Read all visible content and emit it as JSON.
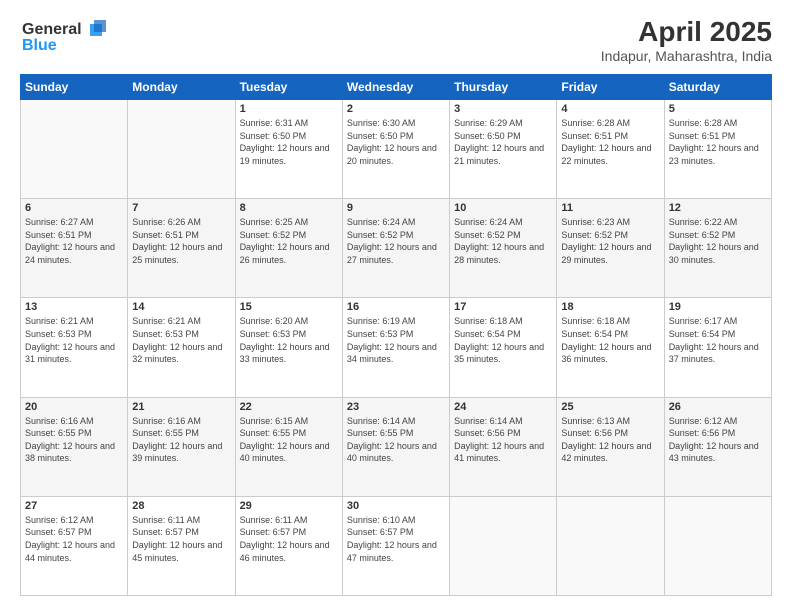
{
  "header": {
    "logo_line1": "General",
    "logo_line2": "Blue",
    "title": "April 2025",
    "subtitle": "Indapur, Maharashtra, India"
  },
  "days_of_week": [
    "Sunday",
    "Monday",
    "Tuesday",
    "Wednesday",
    "Thursday",
    "Friday",
    "Saturday"
  ],
  "weeks": [
    [
      {
        "day": "",
        "sunrise": "",
        "sunset": "",
        "daylight": ""
      },
      {
        "day": "",
        "sunrise": "",
        "sunset": "",
        "daylight": ""
      },
      {
        "day": "1",
        "sunrise": "Sunrise: 6:31 AM",
        "sunset": "Sunset: 6:50 PM",
        "daylight": "Daylight: 12 hours and 19 minutes."
      },
      {
        "day": "2",
        "sunrise": "Sunrise: 6:30 AM",
        "sunset": "Sunset: 6:50 PM",
        "daylight": "Daylight: 12 hours and 20 minutes."
      },
      {
        "day": "3",
        "sunrise": "Sunrise: 6:29 AM",
        "sunset": "Sunset: 6:50 PM",
        "daylight": "Daylight: 12 hours and 21 minutes."
      },
      {
        "day": "4",
        "sunrise": "Sunrise: 6:28 AM",
        "sunset": "Sunset: 6:51 PM",
        "daylight": "Daylight: 12 hours and 22 minutes."
      },
      {
        "day": "5",
        "sunrise": "Sunrise: 6:28 AM",
        "sunset": "Sunset: 6:51 PM",
        "daylight": "Daylight: 12 hours and 23 minutes."
      }
    ],
    [
      {
        "day": "6",
        "sunrise": "Sunrise: 6:27 AM",
        "sunset": "Sunset: 6:51 PM",
        "daylight": "Daylight: 12 hours and 24 minutes."
      },
      {
        "day": "7",
        "sunrise": "Sunrise: 6:26 AM",
        "sunset": "Sunset: 6:51 PM",
        "daylight": "Daylight: 12 hours and 25 minutes."
      },
      {
        "day": "8",
        "sunrise": "Sunrise: 6:25 AM",
        "sunset": "Sunset: 6:52 PM",
        "daylight": "Daylight: 12 hours and 26 minutes."
      },
      {
        "day": "9",
        "sunrise": "Sunrise: 6:24 AM",
        "sunset": "Sunset: 6:52 PM",
        "daylight": "Daylight: 12 hours and 27 minutes."
      },
      {
        "day": "10",
        "sunrise": "Sunrise: 6:24 AM",
        "sunset": "Sunset: 6:52 PM",
        "daylight": "Daylight: 12 hours and 28 minutes."
      },
      {
        "day": "11",
        "sunrise": "Sunrise: 6:23 AM",
        "sunset": "Sunset: 6:52 PM",
        "daylight": "Daylight: 12 hours and 29 minutes."
      },
      {
        "day": "12",
        "sunrise": "Sunrise: 6:22 AM",
        "sunset": "Sunset: 6:52 PM",
        "daylight": "Daylight: 12 hours and 30 minutes."
      }
    ],
    [
      {
        "day": "13",
        "sunrise": "Sunrise: 6:21 AM",
        "sunset": "Sunset: 6:53 PM",
        "daylight": "Daylight: 12 hours and 31 minutes."
      },
      {
        "day": "14",
        "sunrise": "Sunrise: 6:21 AM",
        "sunset": "Sunset: 6:53 PM",
        "daylight": "Daylight: 12 hours and 32 minutes."
      },
      {
        "day": "15",
        "sunrise": "Sunrise: 6:20 AM",
        "sunset": "Sunset: 6:53 PM",
        "daylight": "Daylight: 12 hours and 33 minutes."
      },
      {
        "day": "16",
        "sunrise": "Sunrise: 6:19 AM",
        "sunset": "Sunset: 6:53 PM",
        "daylight": "Daylight: 12 hours and 34 minutes."
      },
      {
        "day": "17",
        "sunrise": "Sunrise: 6:18 AM",
        "sunset": "Sunset: 6:54 PM",
        "daylight": "Daylight: 12 hours and 35 minutes."
      },
      {
        "day": "18",
        "sunrise": "Sunrise: 6:18 AM",
        "sunset": "Sunset: 6:54 PM",
        "daylight": "Daylight: 12 hours and 36 minutes."
      },
      {
        "day": "19",
        "sunrise": "Sunrise: 6:17 AM",
        "sunset": "Sunset: 6:54 PM",
        "daylight": "Daylight: 12 hours and 37 minutes."
      }
    ],
    [
      {
        "day": "20",
        "sunrise": "Sunrise: 6:16 AM",
        "sunset": "Sunset: 6:55 PM",
        "daylight": "Daylight: 12 hours and 38 minutes."
      },
      {
        "day": "21",
        "sunrise": "Sunrise: 6:16 AM",
        "sunset": "Sunset: 6:55 PM",
        "daylight": "Daylight: 12 hours and 39 minutes."
      },
      {
        "day": "22",
        "sunrise": "Sunrise: 6:15 AM",
        "sunset": "Sunset: 6:55 PM",
        "daylight": "Daylight: 12 hours and 40 minutes."
      },
      {
        "day": "23",
        "sunrise": "Sunrise: 6:14 AM",
        "sunset": "Sunset: 6:55 PM",
        "daylight": "Daylight: 12 hours and 40 minutes."
      },
      {
        "day": "24",
        "sunrise": "Sunrise: 6:14 AM",
        "sunset": "Sunset: 6:56 PM",
        "daylight": "Daylight: 12 hours and 41 minutes."
      },
      {
        "day": "25",
        "sunrise": "Sunrise: 6:13 AM",
        "sunset": "Sunset: 6:56 PM",
        "daylight": "Daylight: 12 hours and 42 minutes."
      },
      {
        "day": "26",
        "sunrise": "Sunrise: 6:12 AM",
        "sunset": "Sunset: 6:56 PM",
        "daylight": "Daylight: 12 hours and 43 minutes."
      }
    ],
    [
      {
        "day": "27",
        "sunrise": "Sunrise: 6:12 AM",
        "sunset": "Sunset: 6:57 PM",
        "daylight": "Daylight: 12 hours and 44 minutes."
      },
      {
        "day": "28",
        "sunrise": "Sunrise: 6:11 AM",
        "sunset": "Sunset: 6:57 PM",
        "daylight": "Daylight: 12 hours and 45 minutes."
      },
      {
        "day": "29",
        "sunrise": "Sunrise: 6:11 AM",
        "sunset": "Sunset: 6:57 PM",
        "daylight": "Daylight: 12 hours and 46 minutes."
      },
      {
        "day": "30",
        "sunrise": "Sunrise: 6:10 AM",
        "sunset": "Sunset: 6:57 PM",
        "daylight": "Daylight: 12 hours and 47 minutes."
      },
      {
        "day": "",
        "sunrise": "",
        "sunset": "",
        "daylight": ""
      },
      {
        "day": "",
        "sunrise": "",
        "sunset": "",
        "daylight": ""
      },
      {
        "day": "",
        "sunrise": "",
        "sunset": "",
        "daylight": ""
      }
    ]
  ]
}
